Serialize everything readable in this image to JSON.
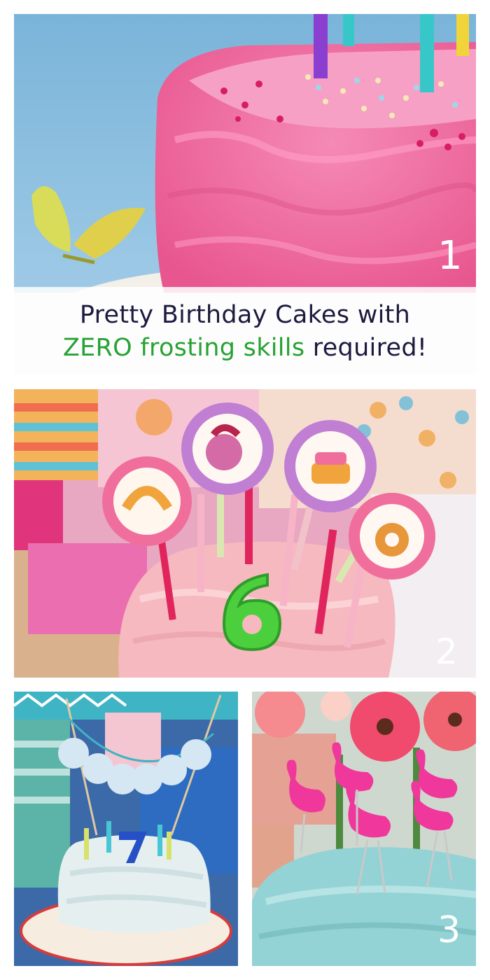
{
  "title": {
    "line1": "Pretty Birthday Cakes with",
    "line2_green": "ZERO frosting skills",
    "line2_rest": " required!"
  },
  "labels": {
    "one": "1",
    "two": "2",
    "three": "3"
  },
  "colors": {
    "title_dark": "#1c1b3f",
    "title_green": "#27a234",
    "pink_frosting": "#f06aa0",
    "blue_frosting": "#8fd3d6",
    "sky": "#7fb8dd"
  }
}
